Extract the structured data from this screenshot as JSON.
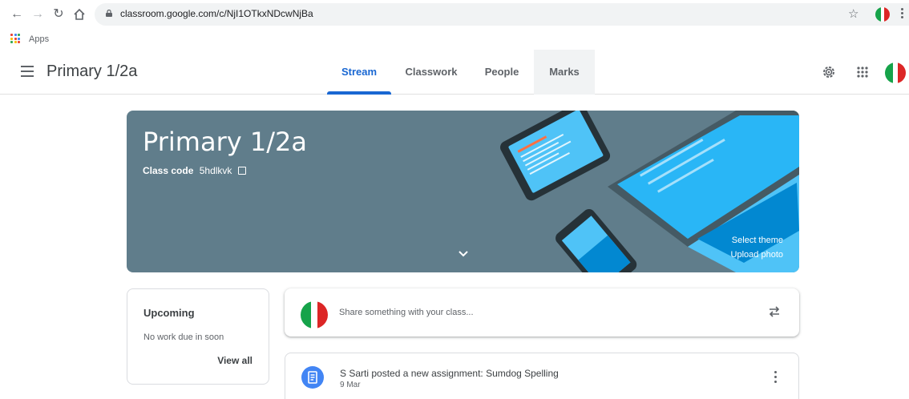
{
  "browser": {
    "url": "classroom.google.com/c/NjI1OTkxNDcwNjBa",
    "bookmarks": [
      {
        "label": "Apps"
      }
    ]
  },
  "header": {
    "title": "Primary 1/2a",
    "tabs": [
      {
        "label": "Stream",
        "active": true
      },
      {
        "label": "Classwork",
        "active": false
      },
      {
        "label": "People",
        "active": false
      },
      {
        "label": "Marks",
        "active": false
      }
    ]
  },
  "banner": {
    "title": "Primary 1/2a",
    "class_code_label": "Class code",
    "class_code": "5hdlkvk",
    "select_theme": "Select theme",
    "upload_photo": "Upload photo",
    "color": "#607d8b"
  },
  "upcoming": {
    "title": "Upcoming",
    "subtitle": "No work due in soon",
    "link": "View all"
  },
  "share": {
    "placeholder": "Share something with your class..."
  },
  "post": {
    "title": "S Sarti posted a new assignment: Sumdog Spelling",
    "date": "9 Mar"
  },
  "colors": {
    "accent": "#1967d2",
    "flag_green": "#16a34a",
    "flag_red": "#dc2626"
  }
}
